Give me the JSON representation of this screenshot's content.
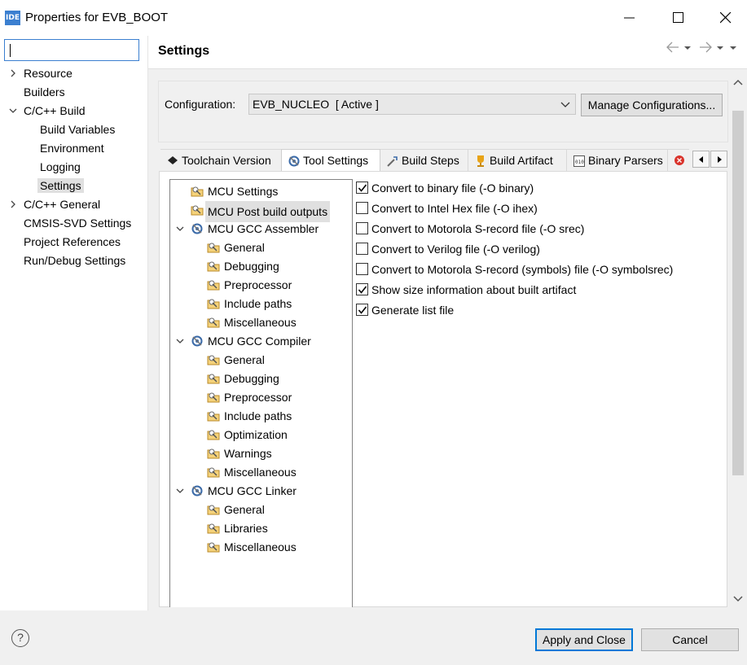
{
  "window": {
    "app_icon_text": "IDE",
    "title": "Properties for EVB_BOOT"
  },
  "filter": {
    "value": "",
    "placeholder": ""
  },
  "nav": {
    "items": [
      {
        "label": "Resource",
        "expander": "collapsed"
      },
      {
        "label": "Builders",
        "expander": "none"
      },
      {
        "label": "C/C++ Build",
        "expander": "expanded"
      },
      {
        "label": "Build Variables",
        "expander": "none"
      },
      {
        "label": "Environment",
        "expander": "none"
      },
      {
        "label": "Logging",
        "expander": "none"
      },
      {
        "label": "Settings",
        "expander": "none",
        "selected": true
      },
      {
        "label": "C/C++ General",
        "expander": "collapsed"
      },
      {
        "label": "CMSIS-SVD Settings",
        "expander": "none"
      },
      {
        "label": "Project References",
        "expander": "none"
      },
      {
        "label": "Run/Debug Settings",
        "expander": "none"
      }
    ]
  },
  "page": {
    "title": "Settings"
  },
  "config": {
    "label": "Configuration:",
    "selected": "EVB_NUCLEO  [ Active ]",
    "manage_label": "Manage Configurations..."
  },
  "tabs": [
    {
      "label": "Toolchain Version",
      "icon": "chip-icon"
    },
    {
      "label": "Tool Settings",
      "icon": "tool-settings-icon",
      "active": true
    },
    {
      "label": "Build Steps",
      "icon": "build-steps-icon"
    },
    {
      "label": "Build Artifact",
      "icon": "trophy-icon"
    },
    {
      "label": "Binary Parsers",
      "icon": "binary-icon"
    },
    {
      "label": "",
      "icon": "error-icon"
    }
  ],
  "tree": {
    "nodes": [
      {
        "label": "MCU Settings",
        "level": 0,
        "icon": "folder-settings-icon"
      },
      {
        "label": "MCU Post build outputs",
        "level": 0,
        "icon": "folder-settings-icon",
        "selected": true
      },
      {
        "label": "MCU GCC Assembler",
        "level": 0,
        "icon": "gear-tool-icon",
        "expander": "expanded"
      },
      {
        "label": "General",
        "level": 1,
        "icon": "folder-settings-icon"
      },
      {
        "label": "Debugging",
        "level": 1,
        "icon": "folder-settings-icon"
      },
      {
        "label": "Preprocessor",
        "level": 1,
        "icon": "folder-settings-icon"
      },
      {
        "label": "Include paths",
        "level": 1,
        "icon": "folder-settings-icon"
      },
      {
        "label": "Miscellaneous",
        "level": 1,
        "icon": "folder-settings-icon"
      },
      {
        "label": "MCU GCC Compiler",
        "level": 0,
        "icon": "gear-tool-icon",
        "expander": "expanded"
      },
      {
        "label": "General",
        "level": 1,
        "icon": "folder-settings-icon"
      },
      {
        "label": "Debugging",
        "level": 1,
        "icon": "folder-settings-icon"
      },
      {
        "label": "Preprocessor",
        "level": 1,
        "icon": "folder-settings-icon"
      },
      {
        "label": "Include paths",
        "level": 1,
        "icon": "folder-settings-icon"
      },
      {
        "label": "Optimization",
        "level": 1,
        "icon": "folder-settings-icon"
      },
      {
        "label": "Warnings",
        "level": 1,
        "icon": "folder-settings-icon"
      },
      {
        "label": "Miscellaneous",
        "level": 1,
        "icon": "folder-settings-icon"
      },
      {
        "label": "MCU GCC Linker",
        "level": 0,
        "icon": "gear-tool-icon",
        "expander": "expanded"
      },
      {
        "label": "General",
        "level": 1,
        "icon": "folder-settings-icon"
      },
      {
        "label": "Libraries",
        "level": 1,
        "icon": "folder-settings-icon"
      },
      {
        "label": "Miscellaneous",
        "level": 1,
        "icon": "folder-settings-icon"
      }
    ]
  },
  "options": [
    {
      "label": "Convert to binary file (-O binary)",
      "checked": true
    },
    {
      "label": "Convert to Intel Hex file (-O ihex)",
      "checked": false
    },
    {
      "label": "Convert to Motorola S-record file (-O srec)",
      "checked": false
    },
    {
      "label": "Convert to Verilog file (-O verilog)",
      "checked": false
    },
    {
      "label": "Convert to Motorola S-record (symbols) file (-O symbolsrec)",
      "checked": false
    },
    {
      "label": "Show size information about built artifact",
      "checked": true
    },
    {
      "label": "Generate list file",
      "checked": true
    }
  ],
  "footer": {
    "help_label": "?",
    "apply_label": "Apply and Close",
    "cancel_label": "Cancel"
  }
}
